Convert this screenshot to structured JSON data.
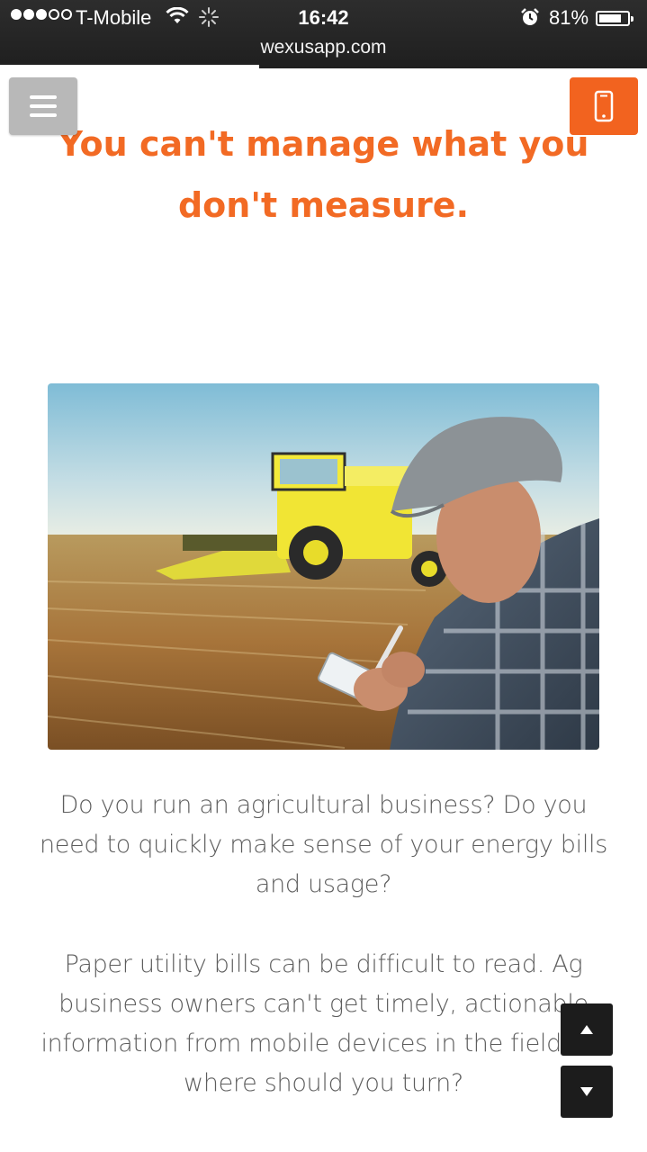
{
  "status_bar": {
    "carrier": "T-Mobile",
    "signal_bars_filled": 3,
    "signal_bars_total": 5,
    "time": "16:42",
    "battery_percent": "81%",
    "battery_level": 0.81
  },
  "browser": {
    "url": "wexusapp.com",
    "load_progress": 0.4
  },
  "header": {
    "menu_icon": "hamburger-icon",
    "phone_icon": "mobile-phone-icon",
    "accent_color": "#f2631f",
    "menu_color": "#b8b8b8"
  },
  "main": {
    "headline": "You can't manage what you don't measure.",
    "paragraph_1": "Do you run an agricultural business? Do you need to quickly make sense of your energy bills and usage?",
    "paragraph_2": "Paper utility bills can be difficult to read. Ag business owners can't get timely, actionable information from mobile devices in the field. So where should you turn?"
  },
  "scroll_controls": {
    "up_icon": "triangle-up-icon",
    "down_icon": "triangle-down-icon"
  }
}
